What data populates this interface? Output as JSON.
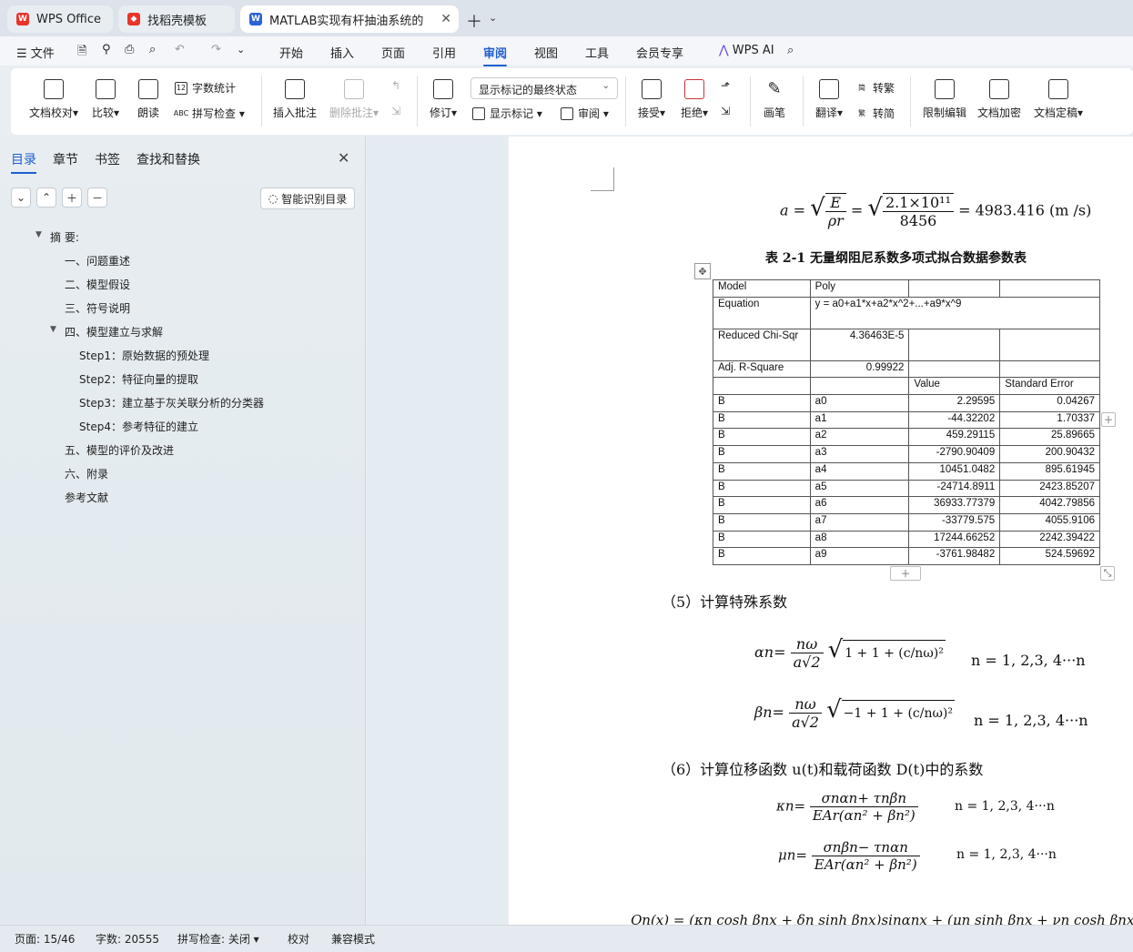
{
  "tabs": [
    {
      "label": "WPS Office"
    },
    {
      "label": "找稻壳模板"
    },
    {
      "label": "MATLAB实现有杆抽油系统的"
    }
  ],
  "menu": {
    "items": [
      "文件",
      "开始",
      "插入",
      "页面",
      "引用",
      "审阅",
      "视图",
      "工具",
      "会员专享",
      "WPS AI"
    ],
    "active": "审阅"
  },
  "ribbon": {
    "doc_check": "文档校对",
    "compare": "比较",
    "read": "朗读",
    "word_count": "字数统计",
    "spell_check": "拼写检查",
    "insert_comment": "插入批注",
    "delete_comment": "删除批注",
    "revise": "修订",
    "markup_mode": "显示标记的最终状态",
    "show_markup": "显示标记",
    "review": "审阅",
    "accept": "接受",
    "reject": "拒绝",
    "pen": "画笔",
    "translate": "翻译",
    "to_trad": "转繁",
    "to_simp": "转简",
    "restrict_edit": "限制编辑",
    "encrypt": "文档加密",
    "finalize": "文档定稿"
  },
  "nav": {
    "tabs": [
      "目录",
      "章节",
      "书签",
      "查找和替换"
    ],
    "smart_toc": "智能识别目录",
    "toc": [
      {
        "label": "摘 要:",
        "level": 0
      },
      {
        "label": "一、问题重述",
        "level": 1
      },
      {
        "label": "二、模型假设",
        "level": 1
      },
      {
        "label": "三、符号说明",
        "level": 1
      },
      {
        "label": "四、模型建立与求解",
        "level": 1
      },
      {
        "label": "Step1：原始数据的预处理",
        "level": 2
      },
      {
        "label": "Step2：特征向量的提取",
        "level": 2
      },
      {
        "label": "Step3：建立基于灰关联分析的分类器",
        "level": 2
      },
      {
        "label": "Step4：参考特征的建立",
        "level": 2
      },
      {
        "label": "五、模型的评价及改进",
        "level": 1
      },
      {
        "label": "六、附录",
        "level": 1
      },
      {
        "label": "参考文献",
        "level": 1
      }
    ]
  },
  "document": {
    "eq_a": {
      "lhs": "a =",
      "num1": "E",
      "den1": "ρr",
      "num2": "2.1×10¹¹",
      "den2": "8456",
      "result": "= 4983.416  (m /s)"
    },
    "table_caption": "表 2-1 无量纲阻尼系数多项式拟合数据参数表",
    "table": {
      "model_label": "Model",
      "model_value": "Poly",
      "equation_label": "Equation",
      "equation_value": "y = a0+a1*x+a2*x^2+...+a9*x^9",
      "chi_label": "Reduced Chi-Sqr",
      "chi_value": "4.36463E-5",
      "r2_label": "Adj. R-Square",
      "r2_value": "0.99922",
      "col_value": "Value",
      "col_error": "Standard Error",
      "rows": [
        [
          "B",
          "a0",
          "2.29595",
          "0.04267"
        ],
        [
          "B",
          "a1",
          "-44.32202",
          "1.70337"
        ],
        [
          "B",
          "a2",
          "459.29115",
          "25.89665"
        ],
        [
          "B",
          "a3",
          "-2790.90409",
          "200.90432"
        ],
        [
          "B",
          "a4",
          "10451.0482",
          "895.61945"
        ],
        [
          "B",
          "a5",
          "-24714.8911",
          "2423.85207"
        ],
        [
          "B",
          "a6",
          "36933.77379",
          "4042.79856"
        ],
        [
          "B",
          "a7",
          "-33779.575",
          "4055.9106"
        ],
        [
          "B",
          "a8",
          "17244.66252",
          "2242.39422"
        ],
        [
          "B",
          "a9",
          "-3761.98482",
          "524.59692"
        ]
      ]
    },
    "section5": "（5）计算特殊系数",
    "eq_alpha": {
      "lhs": "αn=",
      "num": "nω",
      "den": "a√2",
      "root": "1 + 1 + (c/nω)²",
      "range": "n = 1, 2,3, 4···n"
    },
    "eq_beta": {
      "lhs": "βn=",
      "num": "nω",
      "den": "a√2",
      "root": "−1 + 1 + (c/nω)²",
      "range": "n = 1, 2,3, 4···n"
    },
    "section6": "（6）计算位移函数  u(t)和载荷函数  D(t)中的系数",
    "eq_kappa": {
      "lhs": "κn=",
      "num": "σnαn+ τnβn",
      "den": "EAr(αn² + βn²)",
      "range": "n = 1, 2,3, 4···n"
    },
    "eq_mu": {
      "lhs": "μn=",
      "num": "σnβn− τnαn",
      "den": "EAr(αn² + βn²)",
      "range": "n = 1, 2,3, 4···n"
    },
    "eq_bottom": "Qn(x) = (κn cosh βnx + δn sinh βnx)sinαnx + (μn sinh βnx + νn cosh βnx)cosαn x"
  },
  "status": {
    "page": "页面: 15/46",
    "words": "字数: 20555",
    "spell": "拼写检查: 关闭",
    "proof": "校对",
    "compat": "兼容模式"
  },
  "colors": {
    "accent": "#1f5fd0",
    "wps_red": "#e8342b"
  }
}
